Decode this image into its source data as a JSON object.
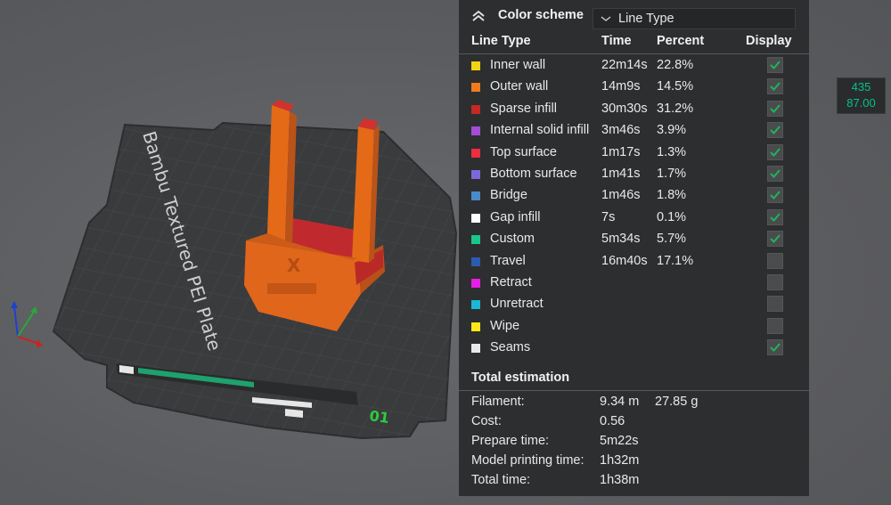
{
  "viewport": {
    "bed_label": "Bambu Textured PEI Plate",
    "plate_number": "01"
  },
  "layer_readout": {
    "layer": "435",
    "height": "87.00"
  },
  "panel": {
    "collapse_icon": "double-chevron-up-icon",
    "color_scheme_label": "Color scheme",
    "scheme_value": "Line Type",
    "columns": [
      "Line Type",
      "Time",
      "Percent",
      "Display"
    ],
    "rows": [
      {
        "name": "Inner wall",
        "time": "22m14s",
        "percent": "22.8%",
        "color": "#f1d214",
        "checked": true
      },
      {
        "name": "Outer wall",
        "time": "14m9s",
        "percent": "14.5%",
        "color": "#f07a1e",
        "checked": true
      },
      {
        "name": "Sparse infill",
        "time": "30m30s",
        "percent": "31.2%",
        "color": "#c42a22",
        "checked": true
      },
      {
        "name": "Internal solid infill",
        "time": "3m46s",
        "percent": "3.9%",
        "color": "#a14ed4",
        "checked": true
      },
      {
        "name": "Top surface",
        "time": "1m17s",
        "percent": "1.3%",
        "color": "#ee2d3f",
        "checked": true
      },
      {
        "name": "Bottom surface",
        "time": "1m41s",
        "percent": "1.7%",
        "color": "#7d67dc",
        "checked": true
      },
      {
        "name": "Bridge",
        "time": "1m46s",
        "percent": "1.8%",
        "color": "#4a8ac8",
        "checked": true
      },
      {
        "name": "Gap infill",
        "time": "7s",
        "percent": "0.1%",
        "color": "#ffffff",
        "checked": true
      },
      {
        "name": "Custom",
        "time": "5m34s",
        "percent": "5.7%",
        "color": "#18c888",
        "checked": true
      },
      {
        "name": "Travel",
        "time": "16m40s",
        "percent": "17.1%",
        "color": "#2b5bb0",
        "checked": false
      },
      {
        "name": "Retract",
        "time": "",
        "percent": "",
        "color": "#e61ee6",
        "checked": false
      },
      {
        "name": "Unretract",
        "time": "",
        "percent": "",
        "color": "#1bb7d6",
        "checked": false
      },
      {
        "name": "Wipe",
        "time": "",
        "percent": "",
        "color": "#ffe81a",
        "checked": false
      },
      {
        "name": "Seams",
        "time": "",
        "percent": "",
        "color": "#e8e8e8",
        "checked": true
      }
    ],
    "total_estimation": {
      "title": "Total estimation",
      "filament_label": "Filament:",
      "filament_length": "9.34 m",
      "filament_weight": "27.85 g",
      "cost_label": "Cost:",
      "cost": "0.56",
      "prepare_label": "Prepare time:",
      "prepare": "5m22s",
      "model_label": "Model printing time:",
      "model": "1h32m",
      "total_label": "Total time:",
      "total": "1h38m"
    }
  },
  "colors": {
    "accent_green": "#00c48a",
    "check_green": "#1fb45a",
    "model_orange": "#e46a17"
  }
}
